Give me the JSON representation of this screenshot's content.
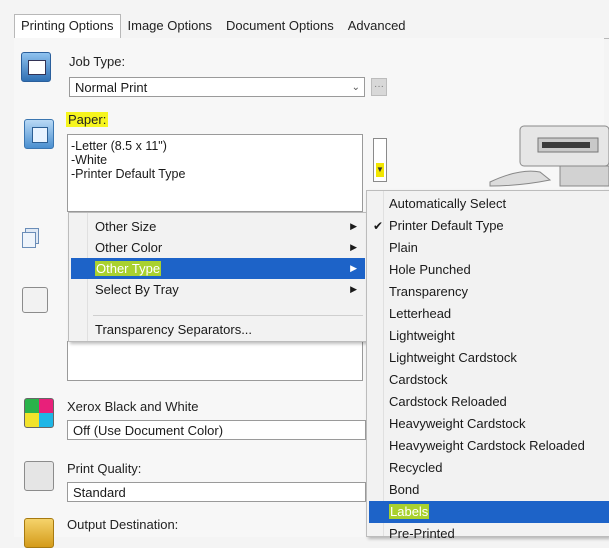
{
  "tabs": [
    "Printing Options",
    "Image Options",
    "Document Options",
    "Advanced"
  ],
  "job_type": {
    "label": "Job Type:",
    "value": "Normal Print"
  },
  "paper": {
    "label": "Paper:",
    "lines": [
      "-Letter (8.5 x 11\")",
      "-White",
      "-Printer Default Type"
    ]
  },
  "color_mode": {
    "label": "Xerox Black and White",
    "value": "Off (Use Document Color)"
  },
  "print_quality": {
    "label": "Print Quality:",
    "value": "Standard"
  },
  "output": {
    "label": "Output Destination:"
  },
  "paper_menu": {
    "items": [
      "Other Size",
      "Other Color",
      "Other Type",
      "Select By Tray"
    ],
    "separator_item": "Transparency Separators...",
    "selected": "Other Type"
  },
  "type_menu": {
    "items": [
      "Automatically Select",
      "Printer Default Type",
      "Plain",
      "Hole Punched",
      "Transparency",
      "Letterhead",
      "Lightweight",
      "Lightweight Cardstock",
      "Cardstock",
      "Cardstock Reloaded",
      "Heavyweight Cardstock",
      "Heavyweight Cardstock Reloaded",
      "Recycled",
      "Bond",
      "Labels",
      "Pre-Printed"
    ],
    "checked": "Printer Default Type",
    "selected": "Labels"
  },
  "colors": {
    "highlight": "#f6f51f",
    "selection": "#1d63c8"
  },
  "icons": [
    "job-type-icon",
    "paper-icon",
    "copies-icon",
    "checkbox",
    "color-mode-icon",
    "quality-icon",
    "output-icon",
    "printer-image"
  ]
}
